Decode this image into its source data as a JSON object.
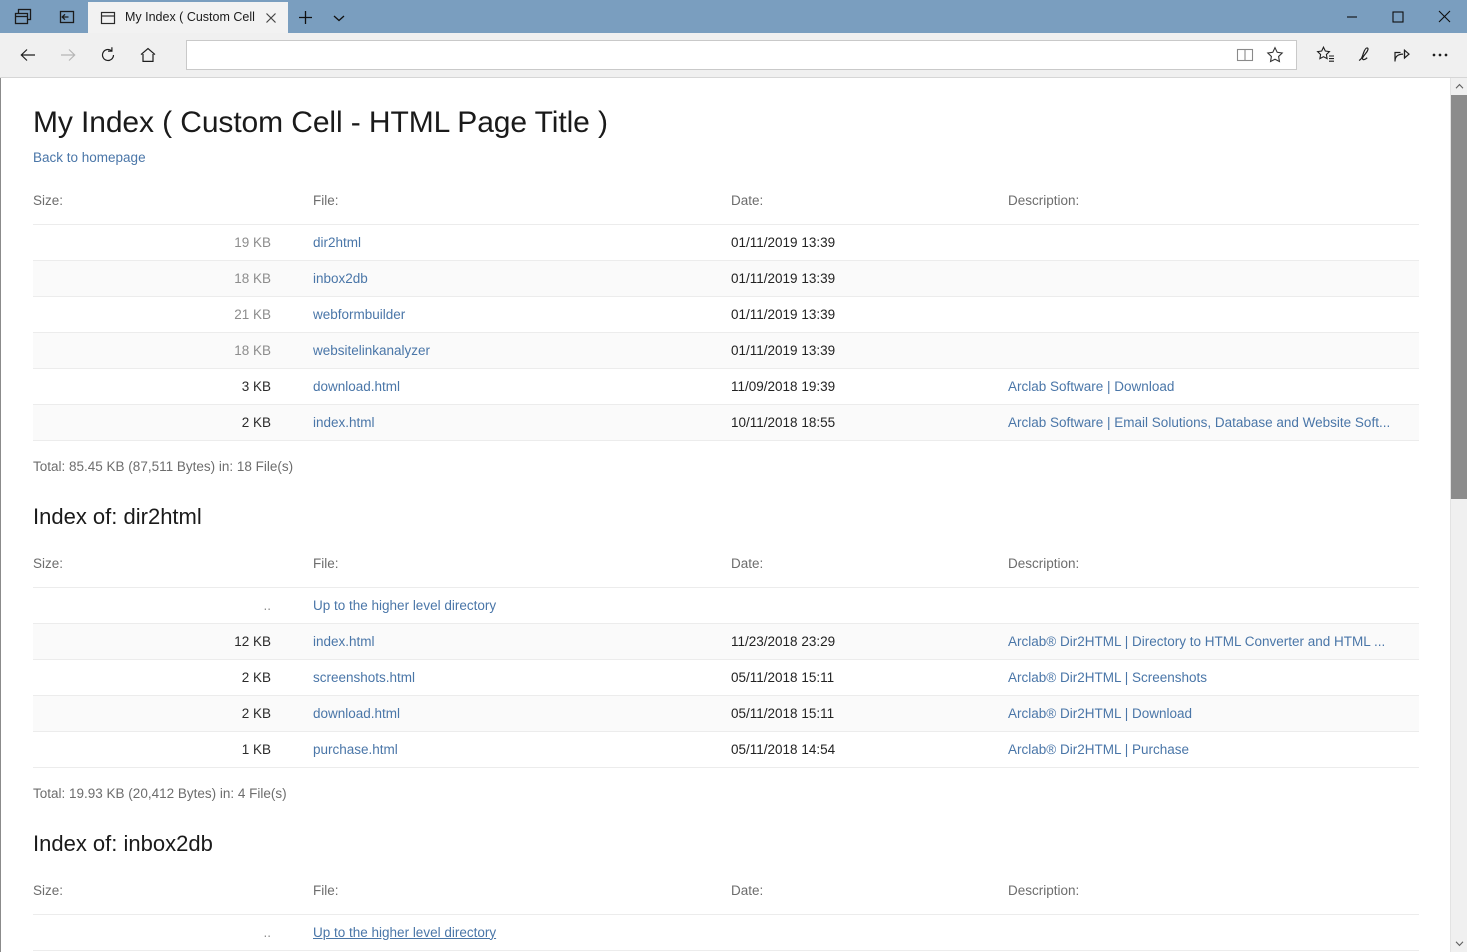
{
  "browser": {
    "tab": {
      "title": "My Index ( Custom Cell",
      "favicon_name": "page-icon",
      "close_label": "✕"
    },
    "newtab_label": "+",
    "tab_menu_label": "⌄",
    "window_controls": {
      "minimize": "─",
      "maximize": "□",
      "close": "✕"
    },
    "toolbar": {
      "back_label": "←",
      "forward_label": "→",
      "refresh_label": "↻",
      "home_label": "⌂",
      "reading_view_name": "reading-view-icon",
      "favorite_name": "star-icon",
      "favorites_hub_name": "favorites-hub-icon",
      "notes_name": "web-notes-pen-icon",
      "share_name": "share-icon",
      "more_label": "⋯"
    },
    "address": {
      "value": "",
      "placeholder": ""
    },
    "titlebar_color": "#7a9ebf",
    "accent_link_color": "#4a76a8"
  },
  "page": {
    "title": "My Index ( Custom Cell - HTML Page Title )",
    "back_link": "Back to homepage",
    "columns": {
      "size": "Size:",
      "file": "File:",
      "date": "Date:",
      "description": "Description:"
    },
    "sections": [
      {
        "heading": null,
        "rows": [
          {
            "size": "19 KB",
            "size_dim": true,
            "file": "dir2html",
            "date": "01/11/2019 13:39",
            "desc": ""
          },
          {
            "size": "18 KB",
            "size_dim": true,
            "file": "inbox2db",
            "date": "01/11/2019 13:39",
            "desc": ""
          },
          {
            "size": "21 KB",
            "size_dim": true,
            "file": "webformbuilder",
            "date": "01/11/2019 13:39",
            "desc": ""
          },
          {
            "size": "18 KB",
            "size_dim": true,
            "file": "websitelinkanalyzer",
            "date": "01/11/2019 13:39",
            "desc": ""
          },
          {
            "size": "3 KB",
            "size_dim": false,
            "file": "download.html",
            "date": "11/09/2018 19:39",
            "desc": "Arclab Software | Download"
          },
          {
            "size": "2 KB",
            "size_dim": false,
            "file": "index.html",
            "date": "10/11/2018 18:55",
            "desc": "Arclab Software | Email Solutions, Database and Website Soft..."
          }
        ],
        "total": "Total: 85.45 KB (87,511 Bytes) in: 18 File(s)"
      },
      {
        "heading": "Index of: dir2html",
        "rows": [
          {
            "size": "..",
            "size_dim": true,
            "file": "Up to the higher level directory",
            "date": "",
            "desc": ""
          },
          {
            "size": "12 KB",
            "size_dim": false,
            "file": "index.html",
            "date": "11/23/2018 23:29",
            "desc": "Arclab® Dir2HTML | Directory to HTML Converter and HTML ..."
          },
          {
            "size": "2 KB",
            "size_dim": false,
            "file": "screenshots.html",
            "date": "05/11/2018 15:11",
            "desc": "Arclab® Dir2HTML | Screenshots"
          },
          {
            "size": "2 KB",
            "size_dim": false,
            "file": "download.html",
            "date": "05/11/2018 15:11",
            "desc": "Arclab® Dir2HTML | Download"
          },
          {
            "size": "1 KB",
            "size_dim": false,
            "file": "purchase.html",
            "date": "05/11/2018 14:54",
            "desc": "Arclab® Dir2HTML | Purchase"
          }
        ],
        "total": "Total: 19.93 KB (20,412 Bytes) in: 4 File(s)"
      },
      {
        "heading": "Index of: inbox2db",
        "rows": [
          {
            "size": "..",
            "size_dim": true,
            "file": "Up to the higher level directory",
            "date": "",
            "desc": "",
            "hovered": true
          }
        ],
        "total": null
      }
    ]
  }
}
